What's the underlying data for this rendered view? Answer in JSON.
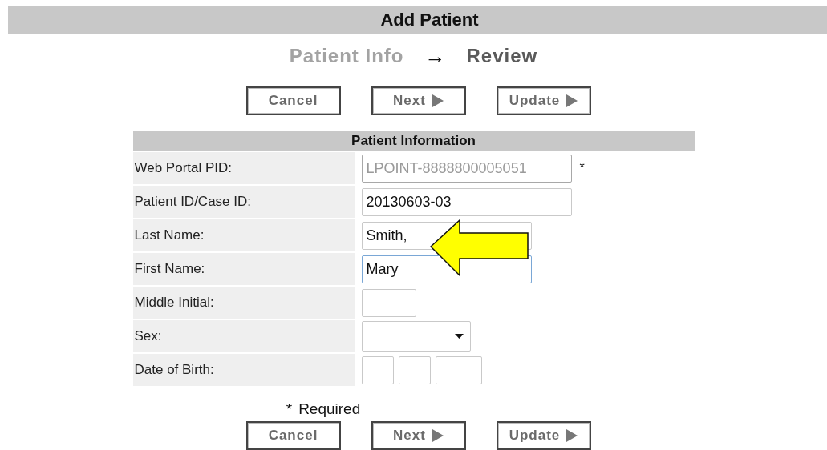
{
  "title": "Add Patient",
  "steps": [
    {
      "label": "Patient Info",
      "selected": false
    },
    {
      "label": "Review",
      "selected": true
    }
  ],
  "step_arrow": "→",
  "top_buttons": [
    {
      "label": "Cancel",
      "kind": "plain"
    },
    {
      "label": "Next",
      "kind": "forward"
    },
    {
      "label": "Update",
      "kind": "forward"
    }
  ],
  "section": {
    "title": "Patient Information",
    "rows": [
      {
        "label": "Web Portal PID:",
        "kind": "text",
        "value": "LPOINT-8888800005051",
        "disabled": true,
        "required": true,
        "focused": false
      },
      {
        "label": "Patient ID/Case ID:",
        "kind": "text",
        "value": "20130603-03",
        "disabled": false,
        "focused": false
      },
      {
        "label": "Last Name:",
        "kind": "text",
        "value": "Smith,",
        "disabled": false,
        "focused": false
      },
      {
        "label": "First Name:",
        "kind": "text",
        "value": "Mary",
        "disabled": false,
        "focused": true
      },
      {
        "label": "Middle Initial:",
        "kind": "text",
        "disabled": false,
        "focused": false
      },
      {
        "label": "Sex:",
        "kind": "select",
        "disabled": false,
        "focused": false
      },
      {
        "label": "Date of Birth:",
        "kind": "date",
        "disabled": false,
        "focused": false
      }
    ]
  },
  "required_mark": "*",
  "required_note": "Required",
  "bottom_buttons": [
    {
      "label": "Cancel",
      "kind": "plain"
    },
    {
      "label": "Next",
      "kind": "forward"
    },
    {
      "label": "Update",
      "kind": "forward"
    }
  ],
  "annotation": {
    "kind": "arrow"
  }
}
